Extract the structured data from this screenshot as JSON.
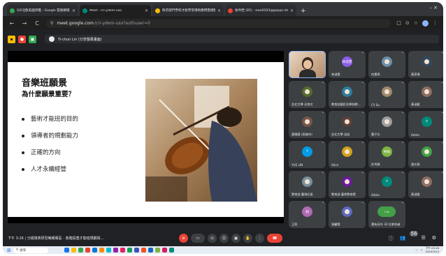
{
  "browser": {
    "tabs": [
      {
        "title": "S/E北歐美國評鑑 - Google 雲端硬碟",
        "favicon_color": "#34a853",
        "active": false
      },
      {
        "title": "Meet - cri-ydem-uso",
        "favicon_color": "#00897b",
        "active": true
      },
      {
        "title": "政府部門學校才能學習場地應用暨相關?/1…",
        "favicon_color": "#fbbc04",
        "active": false
      },
      {
        "title": "收件匣 (85) - ewo0203@gapps.ntnc…",
        "favicon_color": "#ea4335",
        "active": false
      }
    ],
    "new_tab": "+",
    "window_controls": "–  ×",
    "nav": {
      "back": "←",
      "forward": "→",
      "reload": "C"
    },
    "url_host": "meet.google.com",
    "url_path": "/cri-ydem-uso?authuser=0",
    "right_icons": [
      "□",
      "⊙",
      "☆"
    ]
  },
  "meet_bar": {
    "presenter_label": "Yi-chun Lin (分享螢幕畫面)",
    "icon_colors": [
      "#fbbc04",
      "#ea4335",
      "#34a853"
    ]
  },
  "slide": {
    "title": "音樂班願景",
    "subtitle": "為什麼願景重要？",
    "bullets": [
      "藝術才能班的目的",
      "領導者的規劃能力",
      "正確的方向",
      "人才永續經營"
    ]
  },
  "participants": [
    {
      "name": "",
      "avatar": "video",
      "color": "#c9a27a",
      "row": 0,
      "col": 0,
      "speaking": true
    },
    {
      "name": "林淑雯",
      "avatar": "林淑雯",
      "color": "#8e5ce8",
      "row": 0,
      "col": 1
    },
    {
      "name": "何惠琪",
      "avatar": "img",
      "color": "#6d8fa8",
      "row": 0,
      "col": 2
    },
    {
      "name": "黃家瑋",
      "avatar": "img",
      "color": "#34495e",
      "row": 0,
      "col": 3
    },
    {
      "name": "趙祥閔",
      "avatar": "img",
      "color": "#7b68ee",
      "row": 0,
      "col": 4
    },
    {
      "name": "台北大學 呂育文",
      "avatar": "img",
      "color": "#556b2f",
      "row": 1,
      "col": 0
    },
    {
      "name": "教育部國民及學前教...",
      "avatar": "img",
      "color": "#2e7d9e",
      "row": 1,
      "col": 1
    },
    {
      "name": "CY Su",
      "avatar": "img",
      "color": "#a0896b",
      "row": 1,
      "col": 2
    },
    {
      "name": "黃淑媛",
      "avatar": "img",
      "color": "#8d6e63",
      "row": 1,
      "col": 3
    },
    {
      "name": "黃曉凜 (高雄市)",
      "avatar": "img",
      "color": "#795548",
      "row": 2,
      "col": 0
    },
    {
      "name": "台北大學 吳若",
      "avatar": "img",
      "color": "#5d4037",
      "row": 2,
      "col": 1
    },
    {
      "name": "曹子文",
      "avatar": "img",
      "color": "#9e9e9e",
      "row": 2,
      "col": 2
    },
    {
      "name": "Adela",
      "avatar": "A",
      "color": "#00897b",
      "row": 2,
      "col": 3
    },
    {
      "name": "YUE LIN",
      "avatar": "Y",
      "color": "#039be5",
      "row": 3,
      "col": 0
    },
    {
      "name": "Alice",
      "avatar": "img",
      "color": "#d4a017",
      "row": 3,
      "col": 1
    },
    {
      "name": "許秀娟",
      "avatar": "秀娟",
      "color": "#7cb342",
      "row": 3,
      "col": 2
    },
    {
      "name": "潘文堯",
      "avatar": "img",
      "color": "#43a047",
      "row": 3,
      "col": 3
    },
    {
      "name": "教育部 臺灣北區",
      "avatar": "img",
      "color": "#78909c",
      "row": 4,
      "col": 0
    },
    {
      "name": "教育部 藝術教育館",
      "avatar": "img",
      "color": "#6a1b9a",
      "row": 4,
      "col": 1
    },
    {
      "name": "Adela",
      "avatar": "A",
      "color": "#00897b",
      "row": 4,
      "col": 2
    },
    {
      "name": "黃淑媛",
      "avatar": "img",
      "color": "#8d6e63",
      "row": 4,
      "col": 3
    },
    {
      "name": "王翔",
      "avatar": "翔",
      "color": "#b06ab3",
      "row": 5,
      "col": 0
    },
    {
      "name": "張麗雪",
      "avatar": "img",
      "color": "#5c6bc0",
      "row": 5,
      "col": 1
    },
    {
      "name": "還有另外 34 位參與者",
      "avatar": "group",
      "color": "#43a047",
      "row": 5,
      "col": 2
    }
  ],
  "controls": {
    "time_meeting": "下午 3:26  |  分組填表研習簡報專區 - 各階段重才能班規劃與...",
    "buttons": [
      "⊘",
      "▭",
      "⊡",
      "☺",
      "▣",
      "✋",
      "⋮"
    ],
    "hangup": "☎",
    "right": [
      "ⓘ",
      "👥",
      "☰",
      "⚙"
    ],
    "people_count": "56"
  },
  "taskbar": {
    "search": "搜尋",
    "time": "下午 03:26",
    "date": "2024/3/14",
    "app_colors": [
      "#1a73e8",
      "#fbbc04",
      "#34a853",
      "#ea4335",
      "#0078d4",
      "#ff8c00",
      "#00bcd4",
      "#8e24aa",
      "#e91e63",
      "#0f9d58",
      "#3f51b5",
      "#f4511e",
      "#1565c0",
      "#7cb342",
      "#d81b60",
      "#00897b"
    ]
  }
}
